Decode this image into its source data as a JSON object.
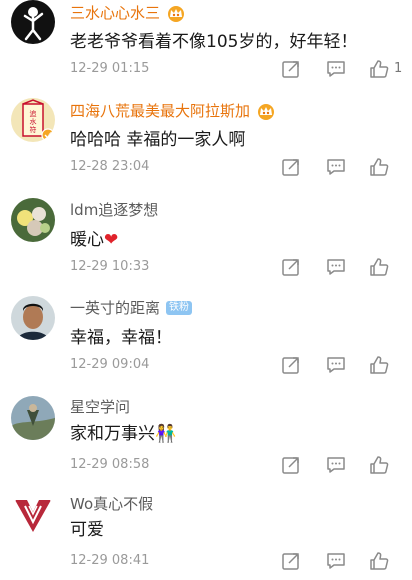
{
  "comments": [
    {
      "username": "三水心心水三",
      "text": "老老爷爷看着不像105岁的，好年轻！",
      "time": "12-29 01:15",
      "like_count": "1",
      "vip": true
    },
    {
      "username": "四海八荒最美最大阿拉斯加",
      "text": "哈哈哈 幸福的一家人啊",
      "time": "12-28 23:04",
      "like_count": "",
      "vip": true,
      "avatar_text": "追水符"
    },
    {
      "username": "ldm追逐梦想",
      "text": "暖心",
      "emoji": "❤",
      "time": "12-29 10:33",
      "like_count": ""
    },
    {
      "username": "一英寸的距离",
      "badge": "铁粉",
      "text": "幸福，幸福！",
      "time": "12-29 09:04",
      "like_count": ""
    },
    {
      "username": "星空学问",
      "text": "家和万事兴",
      "emoji": "👫",
      "time": "12-29 08:58",
      "like_count": ""
    },
    {
      "username": "Wo真心不假",
      "text": "可爱",
      "time": "12-29 08:41",
      "like_count": ""
    }
  ],
  "colors": {
    "vip_name": "#e8740c",
    "normal_name": "#5c5c5c",
    "time_text": "#9a9a9a",
    "action_icon": "#8a8a8a",
    "badge_bg": "#8ec5f2",
    "heart": "#e0232b"
  },
  "icons": {
    "crown": "crown-vip-icon",
    "share": "share-icon",
    "reply": "comment-icon",
    "like": "thumb-up-icon"
  }
}
